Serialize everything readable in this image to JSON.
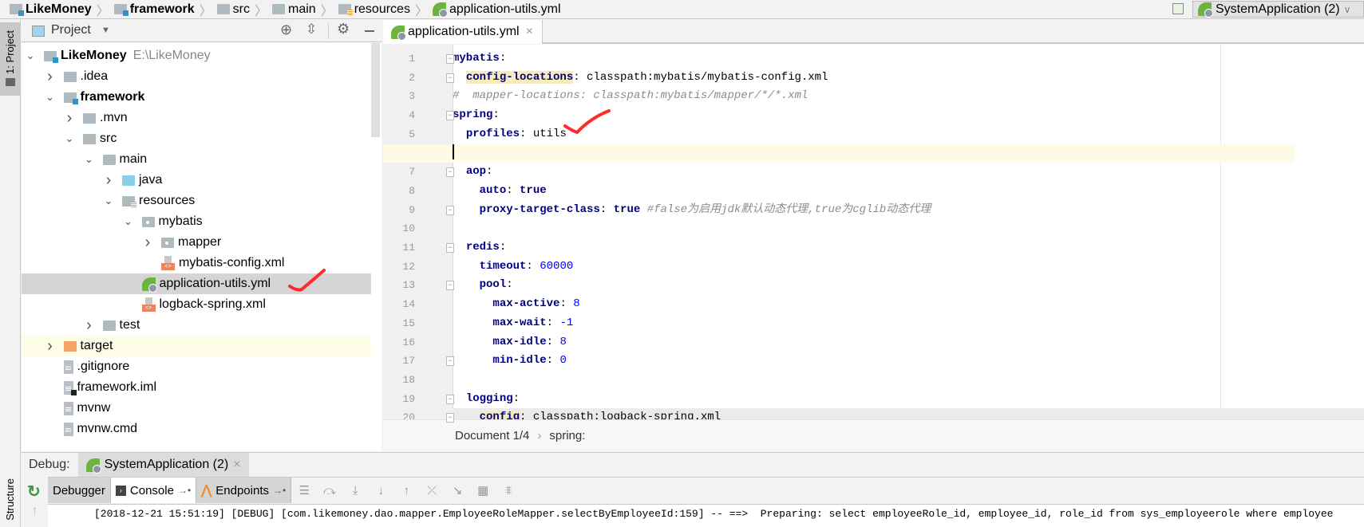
{
  "breadcrumb": [
    {
      "label": "LikeMoney",
      "icon": "module-icon",
      "bold": true
    },
    {
      "label": "framework",
      "icon": "module-icon",
      "bold": true
    },
    {
      "label": "src",
      "icon": "folder-icon"
    },
    {
      "label": "main",
      "icon": "folder-icon"
    },
    {
      "label": "resources",
      "icon": "resources-folder-icon"
    },
    {
      "label": "application-utils.yml",
      "icon": "spring-yml-icon"
    }
  ],
  "run_config": {
    "label": "SystemApplication (2)"
  },
  "left_strip": {
    "project": "1: Project",
    "structure": "Structure"
  },
  "project_panel": {
    "title": "Project"
  },
  "tree": [
    {
      "depth": 0,
      "arrow": "open",
      "icon": "mod",
      "label": "LikeMoney",
      "bold": true,
      "path": "E:\\LikeMoney"
    },
    {
      "depth": 1,
      "arrow": "closed",
      "icon": "folder",
      "label": ".idea"
    },
    {
      "depth": 1,
      "arrow": "open",
      "icon": "mod",
      "label": "framework",
      "bold": true
    },
    {
      "depth": 2,
      "arrow": "closed",
      "icon": "folder",
      "label": ".mvn"
    },
    {
      "depth": 2,
      "arrow": "open",
      "icon": "folder",
      "label": "src"
    },
    {
      "depth": 3,
      "arrow": "open",
      "icon": "folder",
      "label": "main"
    },
    {
      "depth": 4,
      "arrow": "closed",
      "icon": "blue",
      "label": "java"
    },
    {
      "depth": 4,
      "arrow": "open",
      "icon": "res",
      "label": "resources"
    },
    {
      "depth": 5,
      "arrow": "open",
      "icon": "pkg",
      "label": "mybatis"
    },
    {
      "depth": 6,
      "arrow": "closed",
      "icon": "pkg",
      "label": "mapper"
    },
    {
      "depth": 6,
      "arrow": "none",
      "icon": "xml",
      "label": "mybatis-config.xml"
    },
    {
      "depth": 5,
      "arrow": "none",
      "icon": "yml",
      "label": "application-utils.yml",
      "selected": true
    },
    {
      "depth": 5,
      "arrow": "none",
      "icon": "xml",
      "label": "logback-spring.xml"
    },
    {
      "depth": 3,
      "arrow": "closed",
      "icon": "folder",
      "label": "test"
    },
    {
      "depth": 1,
      "arrow": "closed",
      "icon": "orange",
      "label": "target",
      "highlight": true
    },
    {
      "depth": 1,
      "arrow": "none",
      "icon": "txt",
      "label": ".gitignore"
    },
    {
      "depth": 1,
      "arrow": "none",
      "icon": "iml",
      "label": "framework.iml"
    },
    {
      "depth": 1,
      "arrow": "none",
      "icon": "txt",
      "label": "mvnw"
    },
    {
      "depth": 1,
      "arrow": "none",
      "icon": "txt",
      "label": "mvnw.cmd"
    }
  ],
  "editor": {
    "tab": "application-utils.yml",
    "current_line": 6,
    "lines": [
      [
        [
          "k",
          "mybatis"
        ],
        [
          "p",
          ":"
        ]
      ],
      [
        [
          "p",
          "  "
        ],
        [
          "k hk",
          "config-locations"
        ],
        [
          "p",
          ": classpath:mybatis/mybatis-config.xml"
        ]
      ],
      [
        [
          "c",
          "#  mapper-locations: classpath:mybatis/mapper/*/*.xml"
        ]
      ],
      [
        [
          "k",
          "spring"
        ],
        [
          "p",
          ":"
        ]
      ],
      [
        [
          "p",
          "  "
        ],
        [
          "k",
          "profiles"
        ],
        [
          "p",
          ": utils"
        ]
      ],
      [],
      [
        [
          "p",
          "  "
        ],
        [
          "k",
          "aop"
        ],
        [
          "p",
          ":"
        ]
      ],
      [
        [
          "p",
          "    "
        ],
        [
          "k",
          "auto"
        ],
        [
          "p",
          ": "
        ],
        [
          "k",
          "true"
        ]
      ],
      [
        [
          "p",
          "    "
        ],
        [
          "k",
          "proxy-target-class"
        ],
        [
          "p",
          ": "
        ],
        [
          "k",
          "true"
        ],
        [
          "c",
          " #false为启用jdk默认动态代理,true为cglib动态代理"
        ]
      ],
      [],
      [
        [
          "p",
          "  "
        ],
        [
          "k",
          "redis"
        ],
        [
          "p",
          ":"
        ]
      ],
      [
        [
          "p",
          "    "
        ],
        [
          "k",
          "timeout"
        ],
        [
          "p",
          ": "
        ],
        [
          "n",
          "60000"
        ]
      ],
      [
        [
          "p",
          "    "
        ],
        [
          "k",
          "pool"
        ],
        [
          "p",
          ":"
        ]
      ],
      [
        [
          "p",
          "      "
        ],
        [
          "k",
          "max-active"
        ],
        [
          "p",
          ": "
        ],
        [
          "n",
          "8"
        ]
      ],
      [
        [
          "p",
          "      "
        ],
        [
          "k",
          "max-wait"
        ],
        [
          "p",
          ": "
        ],
        [
          "n",
          "-1"
        ]
      ],
      [
        [
          "p",
          "      "
        ],
        [
          "k",
          "max-idle"
        ],
        [
          "p",
          ": "
        ],
        [
          "n",
          "8"
        ]
      ],
      [
        [
          "p",
          "      "
        ],
        [
          "k",
          "min-idle"
        ],
        [
          "p",
          ": "
        ],
        [
          "n",
          "0"
        ]
      ],
      [],
      [
        [
          "p",
          "  "
        ],
        [
          "k",
          "logging"
        ],
        [
          "p",
          ":"
        ]
      ],
      [
        [
          "p",
          "    "
        ],
        [
          "k hk",
          "config"
        ],
        [
          "p",
          ": classpath:logback-spring.xml"
        ]
      ]
    ],
    "folds": {
      "1": "open",
      "2": "end",
      "4": "open",
      "7": "open",
      "9": "end",
      "11": "open",
      "13": "open",
      "17": "end",
      "19": "open",
      "20": "end"
    },
    "breadcrumb": {
      "doc": "Document 1/4",
      "sep": "›",
      "path": "spring:"
    }
  },
  "debug": {
    "label": "Debug:",
    "session": "SystemApplication (2)",
    "tabs": [
      {
        "label": "Debugger"
      },
      {
        "label": "Console",
        "active": true
      },
      {
        "label": "Endpoints"
      }
    ],
    "toolbar_icons": [
      "menu-icon",
      "show-execution-point-icon",
      "step-over-icon",
      "step-into-icon",
      "step-out-icon",
      "drop-frame-icon",
      "run-to-cursor-icon",
      "evaluate-icon",
      "trace-icon"
    ],
    "console_line": "[2018-12-21 15:51:19] [DEBUG] [com.likemoney.dao.mapper.EmployeeRoleMapper.selectByEmployeeId:159] -- ==>  Preparing: select employeeRole_id, employee_id, role_id from sys_employeerole where employee"
  },
  "colors": {
    "keyword": "#000080",
    "number": "#0000ff",
    "comment": "#8c8c8c",
    "selection": "#d5d5d5",
    "current_line": "#fffae3",
    "annotation": "#ff2a2a"
  }
}
